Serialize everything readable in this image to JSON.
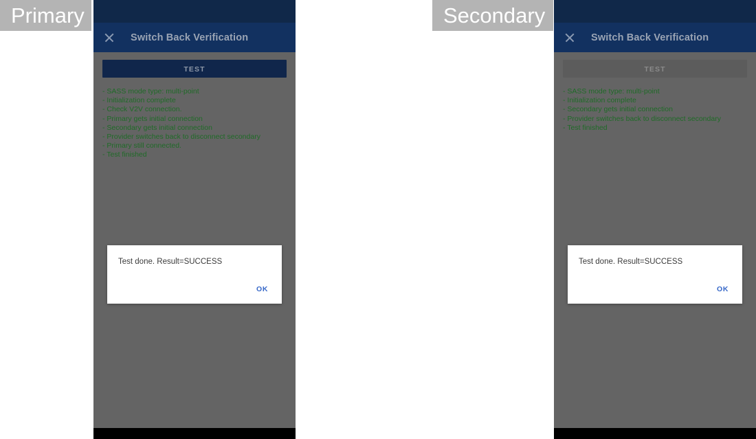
{
  "labels": {
    "primary": "Primary",
    "secondary": "Secondary"
  },
  "colors": {
    "label_bg": "#b4b4b4",
    "statusbar": "#102849",
    "appbar": "#123160",
    "scrim": "#646464",
    "button_enabled": "#10264b",
    "button_disabled": "#5c5c5c",
    "log_text": "#1f6b27",
    "dialog_bg": "#ffffff",
    "dialog_action": "#3768c8",
    "navbar": "#000000"
  },
  "primary": {
    "appbar": {
      "close_icon": "close-icon",
      "title": "Switch Back Verification"
    },
    "test_button": {
      "label": "TEST",
      "state": "enabled"
    },
    "log": [
      "- SASS mode type: multi-point",
      "- Initialization complete",
      "- Check V2V connection.",
      "- Primary gets initial connection",
      "- Secondary gets initial connection",
      "- Provider switches back to disconnect secondary",
      "- Primary still connected.",
      "- Test finished"
    ],
    "dialog": {
      "message": "Test done. Result=SUCCESS",
      "ok_label": "OK"
    }
  },
  "secondary": {
    "appbar": {
      "close_icon": "close-icon",
      "title": "Switch Back Verification"
    },
    "test_button": {
      "label": "TEST",
      "state": "disabled"
    },
    "log": [
      "- SASS mode type: multi-point",
      "- Initialization complete",
      "- Secondary gets initial connection",
      "- Provider switches back to disconnect secondary",
      "- Test finished"
    ],
    "dialog": {
      "message": "Test done. Result=SUCCESS",
      "ok_label": "OK"
    }
  }
}
